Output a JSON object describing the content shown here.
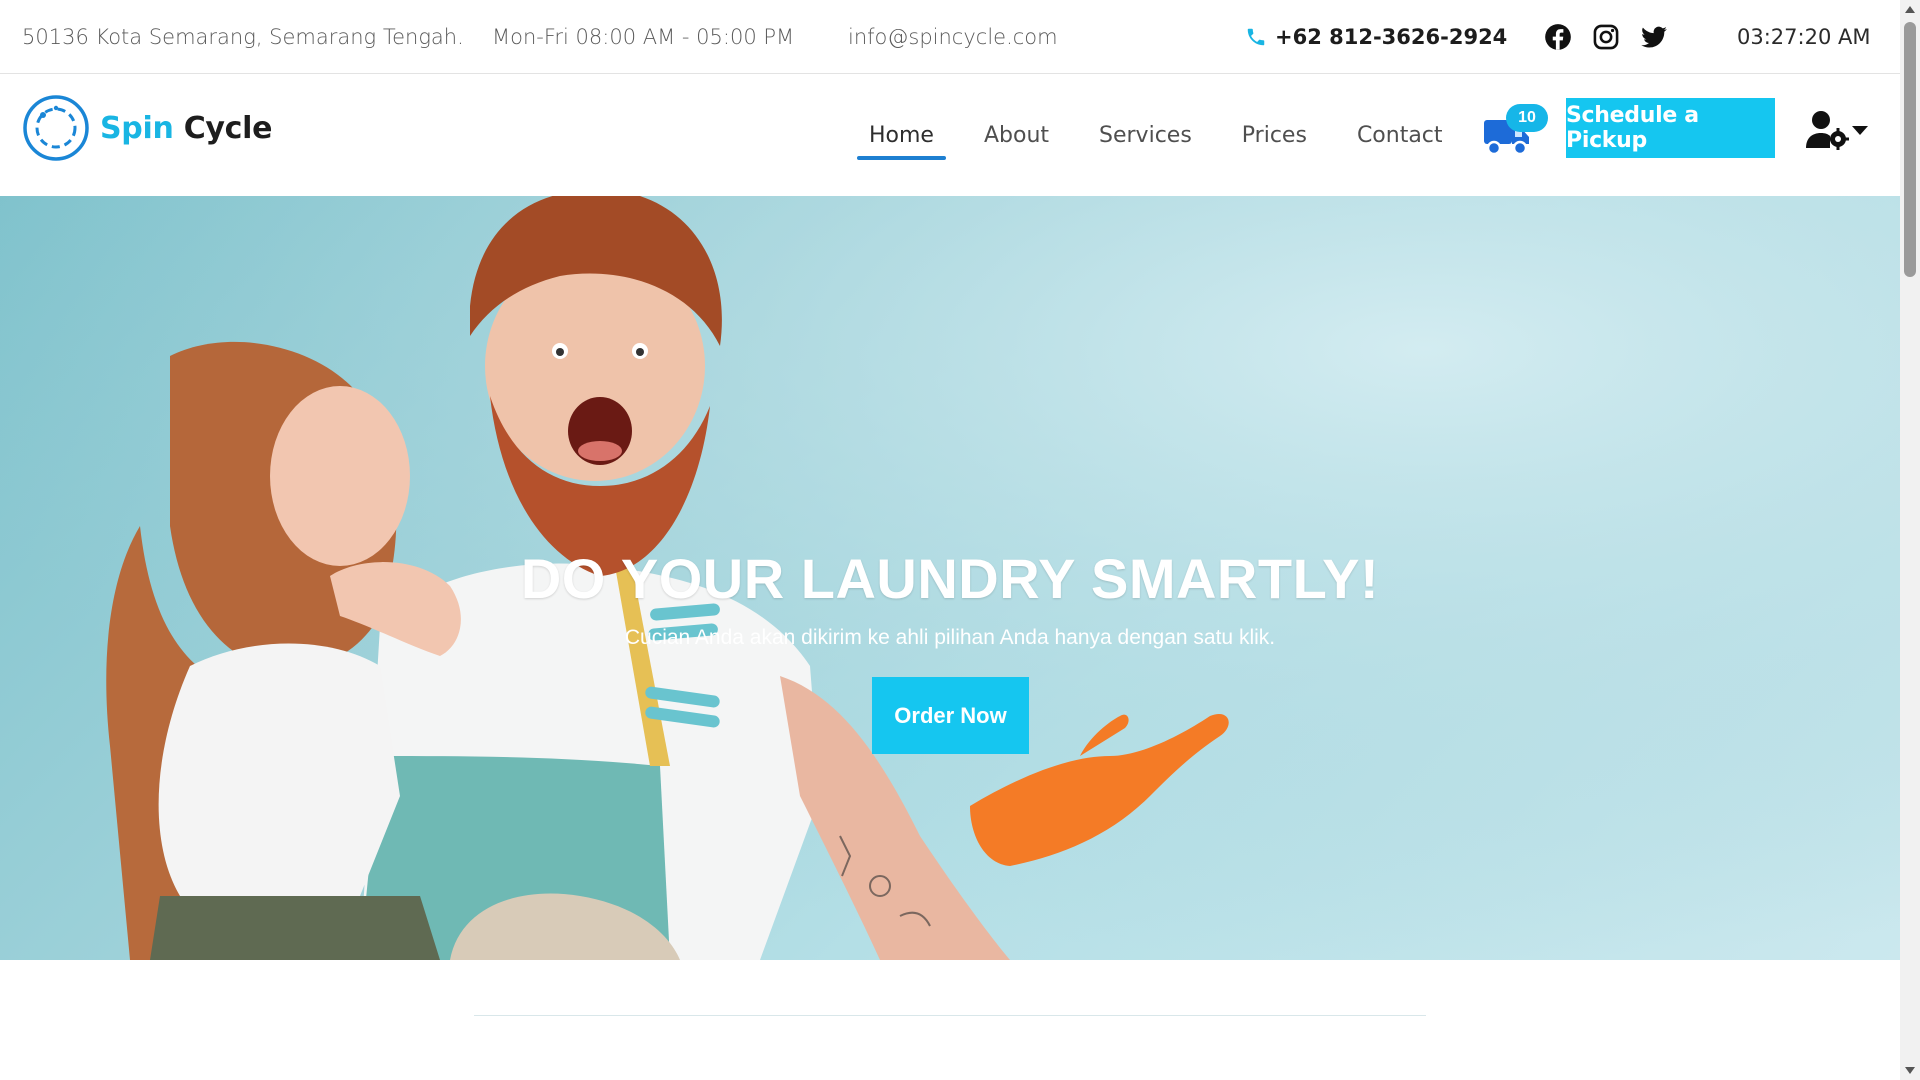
{
  "topbar": {
    "address": "50136 Kota Semarang, Semarang Tengah.",
    "hours": "Mon-Fri 08:00 AM - 05:00 PM",
    "email": "info@spincycle.com",
    "phone": "+62 812-3626-2924",
    "social": [
      "facebook-icon",
      "instagram-icon",
      "twitter-icon"
    ],
    "clock": "03:27:20 AM"
  },
  "brand": {
    "name_part1": "Spin",
    "name_part2": "Cycle"
  },
  "nav": {
    "items": [
      {
        "label": "Home",
        "active": true
      },
      {
        "label": "About",
        "active": false
      },
      {
        "label": "Services",
        "active": false
      },
      {
        "label": "Prices",
        "active": false
      },
      {
        "label": "Contact",
        "active": false
      }
    ]
  },
  "cart": {
    "icon": "truck-icon",
    "count": "10"
  },
  "cta": {
    "label": "Schedule a Pickup"
  },
  "user_menu": {
    "icon": "user-gear-icon"
  },
  "hero": {
    "title": "DO YOUR LAUNDRY SMARTLY!",
    "subtitle": "Cucian Anda akan dikirim ke ahli pilihan Anda hanya dengan satu klik.",
    "button_label": "Order Now"
  },
  "colors": {
    "accent": "#15c6f0",
    "brand_blue": "#19b5e3",
    "nav_active_underline": "#1d7fd1",
    "cart_blue": "#1d6bd8"
  }
}
